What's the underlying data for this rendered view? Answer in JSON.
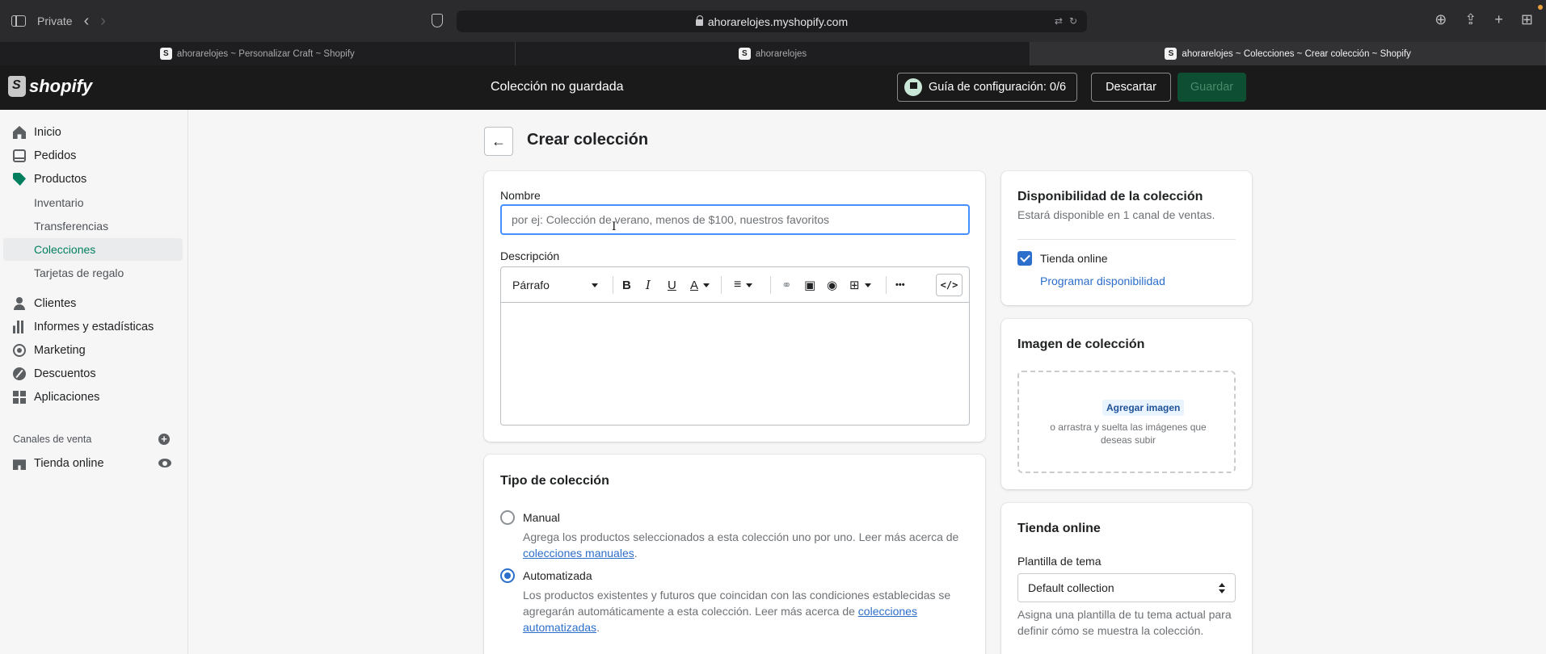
{
  "browser": {
    "mode_label": "Private",
    "url": "ahorarelojes.myshopify.com",
    "tabs": [
      {
        "label": "ahorarelojes ~ Personalizar Craft ~ Shopify"
      },
      {
        "label": "ahorarelojes"
      },
      {
        "label": "ahorarelojes ~ Colecciones ~ Crear colección ~ Shopify"
      }
    ]
  },
  "topbar": {
    "logo_text": "shopify",
    "title": "Colección no guardada",
    "setup_label": "Guía de configuración: 0/6",
    "discard_label": "Descartar",
    "save_label": "Guardar"
  },
  "sidebar": {
    "items": [
      {
        "label": "Inicio",
        "icon": "home-icon"
      },
      {
        "label": "Pedidos",
        "icon": "orders-icon"
      },
      {
        "label": "Productos",
        "icon": "tag-icon"
      },
      {
        "label": "Inventario"
      },
      {
        "label": "Transferencias"
      },
      {
        "label": "Colecciones"
      },
      {
        "label": "Tarjetas de regalo"
      },
      {
        "label": "Clientes",
        "icon": "person-icon"
      },
      {
        "label": "Informes y estadísticas",
        "icon": "bar-chart-icon"
      },
      {
        "label": "Marketing",
        "icon": "target-icon"
      },
      {
        "label": "Descuentos",
        "icon": "discount-icon"
      },
      {
        "label": "Aplicaciones",
        "icon": "apps-icon"
      }
    ],
    "channels_label": "Canales de venta",
    "online_store": "Tienda online"
  },
  "page": {
    "title": "Crear colección",
    "name_label": "Nombre",
    "name_placeholder": "por ej: Colección de verano, menos de $100, nuestros favoritos",
    "name_value": "",
    "description_label": "Descripción",
    "toolbar": {
      "paragraph": "Párrafo",
      "bold": "B",
      "italic": "I",
      "underline": "U",
      "text_color": "A",
      "more": "•••",
      "code": "</>"
    },
    "collection_type": {
      "title": "Tipo de colección",
      "manual_label": "Manual",
      "manual_desc_1": "Agrega los productos seleccionados a esta colección uno por uno. Leer más acerca de ",
      "manual_link": "colecciones manuales",
      "auto_label": "Automatizada",
      "auto_desc_1": "Los productos existentes y futuros que coincidan con las condiciones establecidas se agregarán automáticamente a esta colección. Leer más acerca de ",
      "auto_link": "colecciones automatizadas",
      "selected": "Automatizada"
    }
  },
  "availability": {
    "title": "Disponibilidad de la colección",
    "subtitle": "Estará disponible en 1 canal de ventas.",
    "channel_label": "Tienda online",
    "channel_checked": true,
    "schedule_link": "Programar disponibilidad"
  },
  "image_card": {
    "title": "Imagen de colección",
    "add_label": "Agregar imagen",
    "hint": "o arrastra y suelta las imágenes que deseas subir"
  },
  "store_card": {
    "title": "Tienda online",
    "template_label": "Plantilla de tema",
    "template_value": "Default collection",
    "help": "Asigna una plantilla de tu tema actual para definir cómo se muestra la colección."
  }
}
